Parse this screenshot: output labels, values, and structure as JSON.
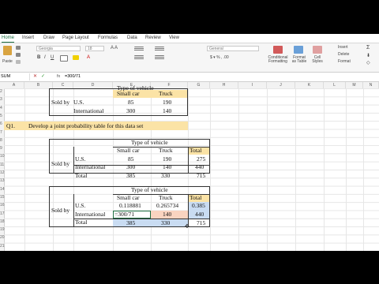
{
  "ribbon": {
    "tabs": [
      "Home",
      "Insert",
      "Draw",
      "Page Layout",
      "Formulas",
      "Data",
      "Review",
      "View"
    ],
    "active_tab": "Home",
    "paste_label": "Paste",
    "font_name": "Georgia",
    "font_size": "18",
    "number_format": "General",
    "conditional_formatting": "Conditional Formatting",
    "format_as_table": "Format as Table",
    "cell_styles": "Cell Styles",
    "insert": "Insert",
    "delete": "Delete",
    "format": "Format"
  },
  "formula_bar": {
    "name_box": "SUM",
    "fx": "fx",
    "formula": "=300/71"
  },
  "columns": [
    "A",
    "B",
    "C",
    "D",
    "E",
    "F",
    "G",
    "H",
    "I",
    "J",
    "K",
    "L",
    "M",
    "N"
  ],
  "rows": [
    "2",
    "3",
    "4",
    "5",
    "6",
    "7",
    "8",
    "9",
    "10",
    "11",
    "12",
    "13",
    "14",
    "15",
    "16",
    "17",
    "18",
    "19",
    "20",
    "21",
    "22",
    "23",
    "24",
    "25"
  ],
  "table0": {
    "header_partial": "Type of vehicle",
    "row_label": "Sold by",
    "col_small": "Small car",
    "col_truck": "Truck",
    "us": "U.S.",
    "intl": "International",
    "us_small": "85",
    "us_truck": "190",
    "intl_small": "300",
    "intl_truck": "140"
  },
  "question": {
    "label": "Q1.",
    "text": "Develop a joint probability table for this data set"
  },
  "table1": {
    "header": "Type of vehicle",
    "row_label": "Sold by",
    "col_small": "Small car",
    "col_truck": "Truck",
    "col_total": "Total",
    "us": "U.S.",
    "intl": "International",
    "total": "Total",
    "us_small": "85",
    "us_truck": "190",
    "us_total": "275",
    "intl_small": "300",
    "intl_truck": "140",
    "intl_total": "440",
    "tot_small": "385",
    "tot_truck": "330",
    "tot_total": "715"
  },
  "table2": {
    "header": "Type of vehicle",
    "row_label": "Sold by",
    "col_small": "Small car",
    "col_truck": "Truck",
    "col_total": "Total",
    "us": "U.S.",
    "intl": "International",
    "total": "Total",
    "us_small": "0.118881",
    "us_truck": "0.265734",
    "us_total": "0.385",
    "intl_small": "=300/71",
    "intl_truck": "140",
    "intl_total": "440",
    "tot_small": "385",
    "tot_truck": "330",
    "tot_total": "715"
  },
  "colors": {
    "excel_green": "#1d6f42",
    "yellow_fill": "#fbe3a6",
    "orange_fill": "#fad4c0",
    "blue_fill": "#c9dcf2"
  }
}
